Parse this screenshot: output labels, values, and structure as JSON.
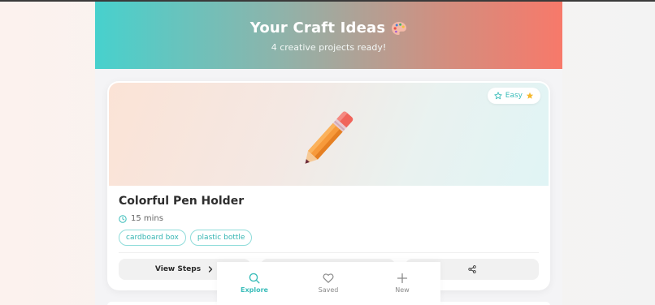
{
  "header": {
    "title": "Your Craft Ideas",
    "subtitle": "4 creative projects ready!",
    "title_emoji_icon": "palette-icon"
  },
  "card": {
    "difficulty": "Easy",
    "title": "Colorful Pen Holder",
    "time": "15 mins",
    "tags": [
      "cardboard box",
      "plastic bottle"
    ],
    "view_steps_label": "View Steps",
    "hero_icon": "pencil-icon"
  },
  "nav": {
    "explore": "Explore",
    "saved": "Saved",
    "new": "New"
  },
  "colors": {
    "accent": "#3bbdba",
    "header_start": "#47d1cd",
    "header_end": "#f7796a"
  }
}
